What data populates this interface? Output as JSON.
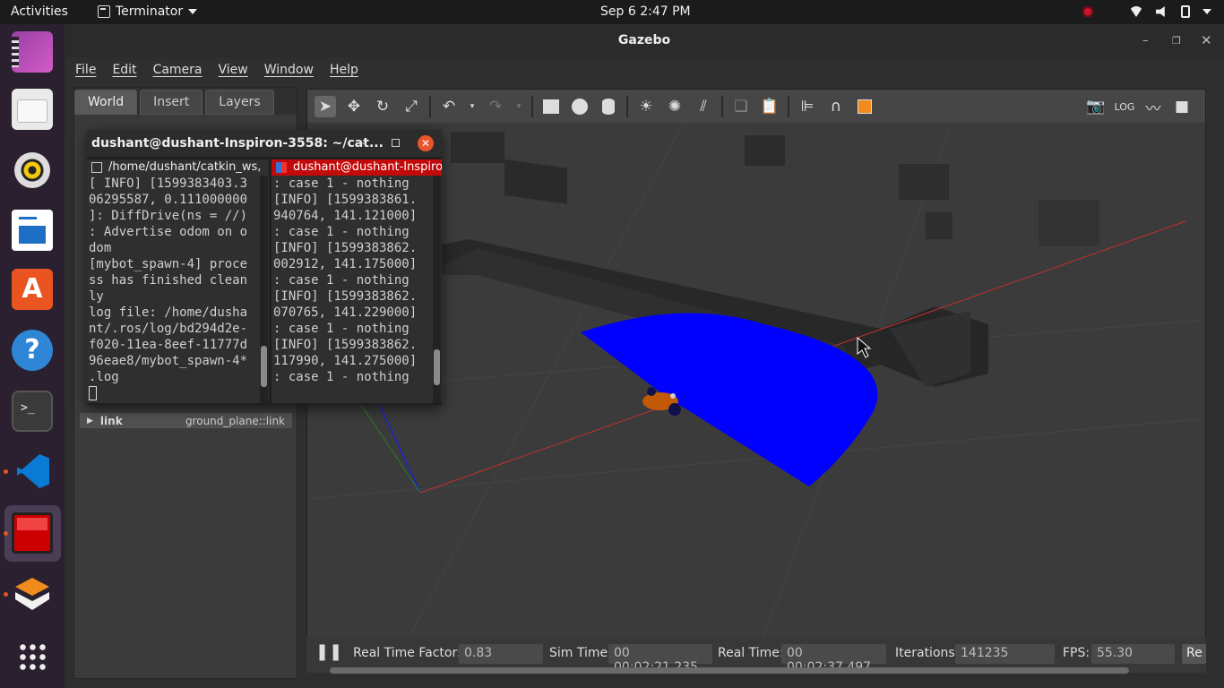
{
  "topbar": {
    "activities": "Activities",
    "app_name": "Terminator",
    "clock": "Sep 6  2:47 PM"
  },
  "dock": {
    "items": [
      "videos",
      "files",
      "rhythmbox",
      "writer",
      "software",
      "help",
      "terminal",
      "vscode",
      "terminator",
      "gazebo",
      "app-grid"
    ]
  },
  "gazebo": {
    "title": "Gazebo",
    "menu": [
      "File",
      "Edit",
      "Camera",
      "View",
      "Window",
      "Help"
    ],
    "tabs": [
      "World",
      "Insert",
      "Layers"
    ],
    "tree_row": {
      "name": "link",
      "value": "ground_plane::link"
    },
    "bottom": {
      "rtf_label": "Real Time Factor:",
      "rtf_value": "0.83",
      "sim_label": "Sim Time:",
      "sim_value": "00 00:02:21.235",
      "real_label": "Real Time:",
      "real_value": "00 00:02:37.497",
      "iter_label": "Iterations:",
      "iter_value": "141235",
      "fps_label": "FPS:",
      "fps_value": "55.30",
      "reset_label": "Re"
    }
  },
  "terminator": {
    "title": "dushant@dushant-Inspiron-3558: ~/cat...",
    "left_pane": {
      "header": "/home/dushant/catkin_ws,",
      "lines": "[ INFO] [1599383403.3\n06295587, 0.111000000\n]: DiffDrive(ns = //)\n: Advertise odom on o\ndom\n[mybot_spawn-4] proce\nss has finished clean\nly\nlog file: /home/dusha\nnt/.ros/log/bd294d2e-\nf020-11ea-8eef-11777d\n96eae8/mybot_spawn-4*\n.log"
    },
    "right_pane": {
      "header": "dushant@dushant-Inspiro",
      "lines": ": case 1 - nothing\n[INFO] [1599383861.\n940764, 141.121000]\n: case 1 - nothing\n[INFO] [1599383862.\n002912, 141.175000]\n: case 1 - nothing\n[INFO] [1599383862.\n070765, 141.229000]\n: case 1 - nothing\n[INFO] [1599383862.\n117990, 141.275000]\n: case 1 - nothing"
    }
  },
  "colors": {
    "laser": "#0000ff",
    "robot": "#c25a05",
    "ubuntu_orange": "#e95420",
    "terminator_active": "#c30a0a"
  }
}
